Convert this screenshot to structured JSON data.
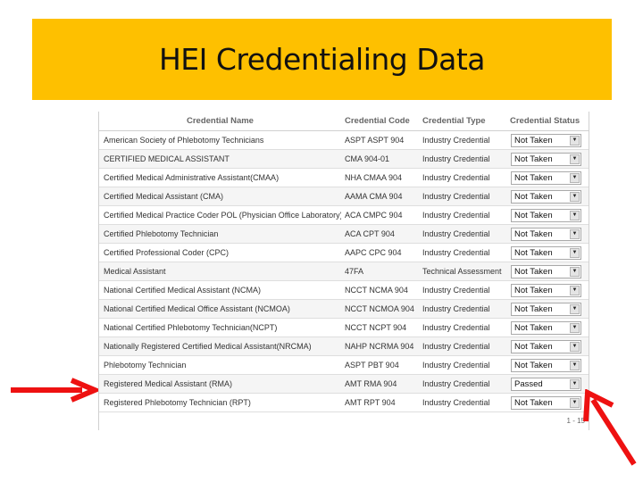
{
  "slide": {
    "title": "HEI Credentialing Data",
    "banner_color": "#fec000",
    "arrow_color": "#ee1111"
  },
  "grid": {
    "columns": [
      "Credential Name",
      "Credential Code",
      "Credential Type",
      "Credential Status"
    ],
    "rows": [
      {
        "name": "American Society of Phlebotomy Technicians",
        "code": "ASPT ASPT 904",
        "type": "Industry Credential",
        "status": "Not Taken"
      },
      {
        "name": "CERTIFIED MEDICAL ASSISTANT",
        "code": "CMA 904-01",
        "type": "Industry Credential",
        "status": "Not Taken"
      },
      {
        "name": "Certified Medical Administrative Assistant(CMAA)",
        "code": "NHA CMAA 904",
        "type": "Industry Credential",
        "status": "Not Taken"
      },
      {
        "name": "Certified Medical Assistant (CMA)",
        "code": "AAMA CMA 904",
        "type": "Industry Credential",
        "status": "Not Taken"
      },
      {
        "name": "Certified Medical Practice Coder POL (Physician Office Laboratory)",
        "code": "ACA CMPC 904",
        "type": "Industry Credential",
        "status": "Not Taken"
      },
      {
        "name": "Certified Phlebotomy Technician",
        "code": "ACA CPT 904",
        "type": "Industry Credential",
        "status": "Not Taken"
      },
      {
        "name": "Certified Professional Coder (CPC)",
        "code": "AAPC CPC 904",
        "type": "Industry Credential",
        "status": "Not Taken"
      },
      {
        "name": "Medical Assistant",
        "code": "47FA",
        "type": "Technical Assessment",
        "status": "Not Taken"
      },
      {
        "name": "National Certified Medical Assistant (NCMA)",
        "code": "NCCT NCMA 904",
        "type": "Industry Credential",
        "status": "Not Taken"
      },
      {
        "name": "National Certified Medical Office Assistant (NCMOA)",
        "code": "NCCT NCMOA 904",
        "type": "Industry Credential",
        "status": "Not Taken"
      },
      {
        "name": "National Certified Phlebotomy Technician(NCPT)",
        "code": "NCCT NCPT 904",
        "type": "Industry Credential",
        "status": "Not Taken"
      },
      {
        "name": "Nationally Registered Certified Medical Assistant(NRCMA)",
        "code": "NAHP NCRMA 904",
        "type": "Industry Credential",
        "status": "Not Taken"
      },
      {
        "name": "Phlebotomy Technician",
        "code": "ASPT PBT 904",
        "type": "Industry Credential",
        "status": "Not Taken"
      },
      {
        "name": "Registered Medical Assistant (RMA)",
        "code": "AMT RMA 904",
        "type": "Industry Credential",
        "status": "Passed"
      },
      {
        "name": "Registered Phlebotomy Technician (RPT)",
        "code": "AMT RPT 904",
        "type": "Industry Credential",
        "status": "Not Taken"
      }
    ],
    "pager": "1 - 15",
    "dropdown_icon": "triangle-down"
  }
}
